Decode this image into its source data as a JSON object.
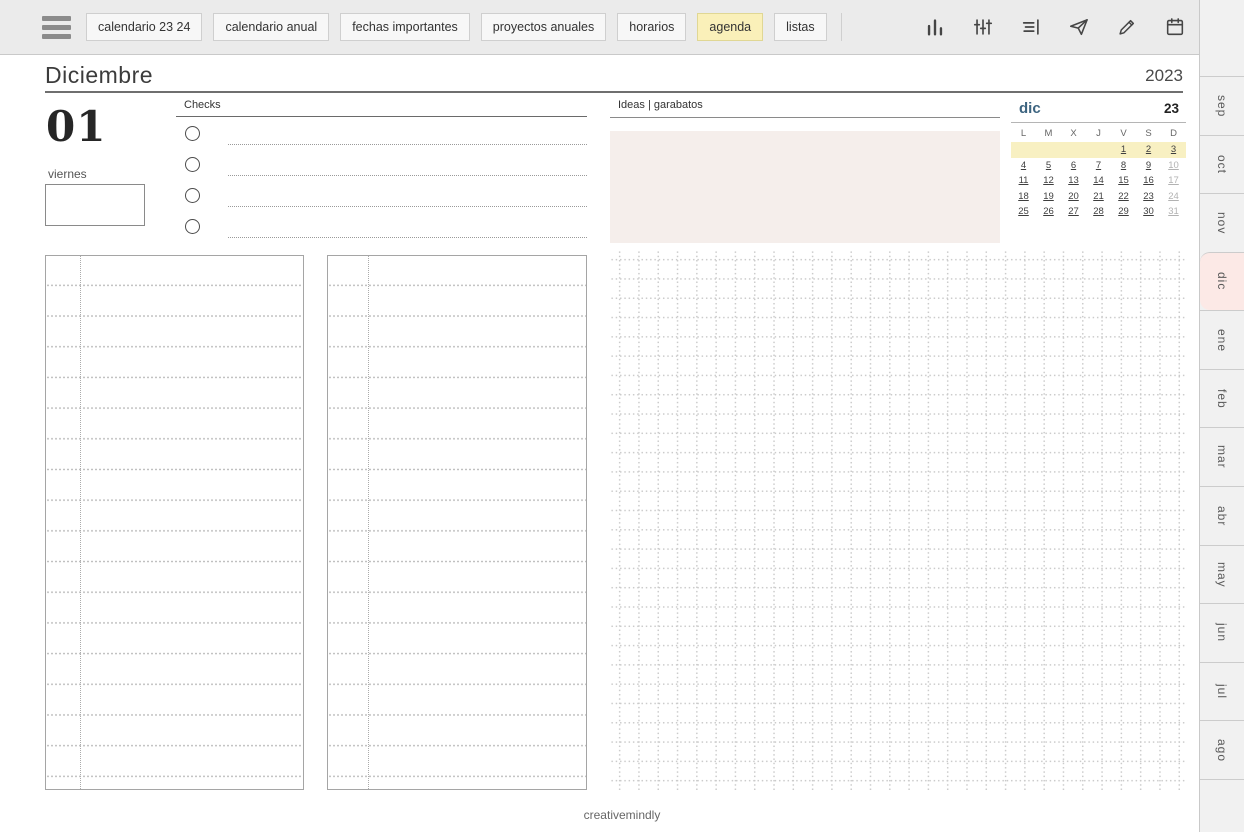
{
  "topbar": {
    "tabs": [
      {
        "label": "calendario 23 24",
        "active": false
      },
      {
        "label": "calendario anual",
        "active": false
      },
      {
        "label": "fechas importantes",
        "active": false
      },
      {
        "label": "proyectos anuales",
        "active": false
      },
      {
        "label": "horarios",
        "active": false
      },
      {
        "label": "agenda",
        "active": true
      },
      {
        "label": "listas",
        "active": false
      }
    ],
    "icons": [
      "bar-chart-icon",
      "equalizer-icon",
      "list-icon",
      "send-icon",
      "pencil-icon",
      "calendar-icon"
    ]
  },
  "header": {
    "month": "Diciembre",
    "year": "2023"
  },
  "day": {
    "number": "01",
    "weekday": "viernes"
  },
  "checks": {
    "title": "Checks",
    "rows": 4
  },
  "ideas": {
    "title": "Ideas | garabatos"
  },
  "mini_calendar": {
    "month": "dic",
    "year": "23",
    "day_headers": [
      "L",
      "M",
      "X",
      "J",
      "V",
      "S",
      "D"
    ],
    "weeks": [
      [
        "",
        "",
        "",
        "",
        "1",
        "2",
        "3"
      ],
      [
        "4",
        "5",
        "6",
        "7",
        "8",
        "9",
        "10"
      ],
      [
        "11",
        "12",
        "13",
        "14",
        "15",
        "16",
        "17"
      ],
      [
        "18",
        "19",
        "20",
        "21",
        "22",
        "23",
        "24"
      ],
      [
        "25",
        "26",
        "27",
        "28",
        "29",
        "30",
        "31"
      ]
    ],
    "muted_dates": [
      "10",
      "17",
      "24",
      "31"
    ],
    "highlighted_week_index": 0
  },
  "sidebar": {
    "months": [
      {
        "label": "sep",
        "active": false
      },
      {
        "label": "oct",
        "active": false
      },
      {
        "label": "nov",
        "active": false
      },
      {
        "label": "dic",
        "active": true
      },
      {
        "label": "ene",
        "active": false
      },
      {
        "label": "feb",
        "active": false
      },
      {
        "label": "mar",
        "active": false
      },
      {
        "label": "abr",
        "active": false
      },
      {
        "label": "may",
        "active": false
      },
      {
        "label": "jun",
        "active": false
      },
      {
        "label": "jul",
        "active": false
      },
      {
        "label": "ago",
        "active": false
      }
    ]
  },
  "footer": {
    "brand": "creativemindly"
  },
  "colors": {
    "active_tab": "#faf0b9",
    "week_highlight": "#f8f0c2",
    "active_month_tab": "#fce9e6",
    "ideas_box": "#f5eeeb",
    "mini_cal_month": "#3d6480"
  }
}
